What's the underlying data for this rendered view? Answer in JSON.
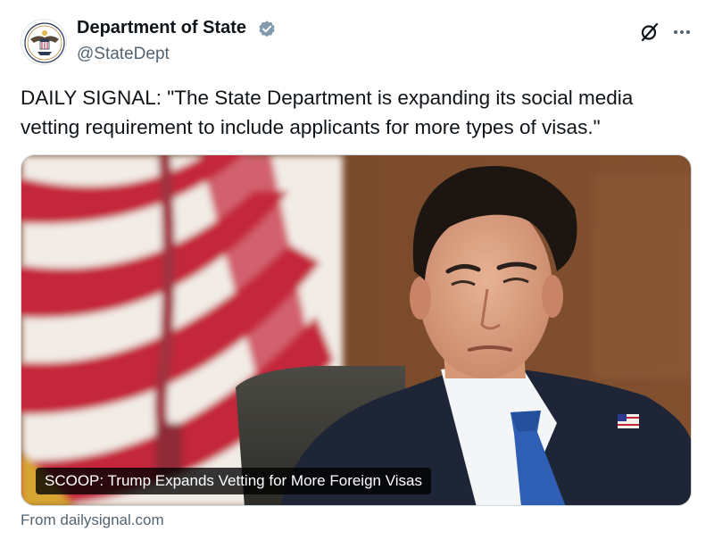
{
  "author": {
    "display_name": "Department of State",
    "handle": "@StateDept",
    "verified": true,
    "avatar_icon": "state-department-seal-icon"
  },
  "tweet": {
    "text": "DAILY SIGNAL: \"The State Department is expanding its social media vetting requirement to include applicants for more types of visas.\""
  },
  "link_card": {
    "headline": "SCOOP: Trump Expands Vetting for More Foreign Visas",
    "source": "From dailysignal.com"
  },
  "icons": {
    "verified": "verified-badge-icon",
    "grok": "grok-icon",
    "more": "more-options-icon"
  },
  "colors": {
    "text": "#0f1419",
    "secondary_text": "#536471",
    "verified": "#829aab"
  }
}
